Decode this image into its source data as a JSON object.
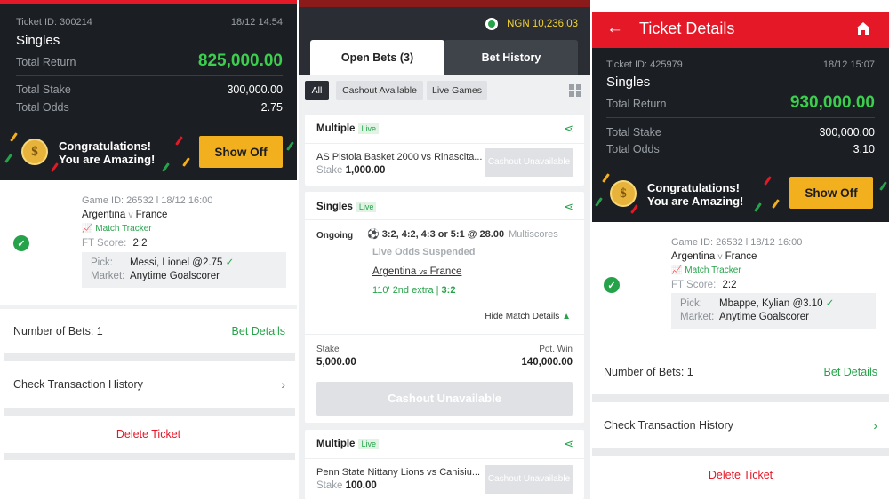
{
  "left": {
    "ticket_id": "Ticket ID: 300214",
    "datetime": "18/12 14:54",
    "type": "Singles",
    "total_return_label": "Total Return",
    "total_return": "825,000.00",
    "total_stake_label": "Total Stake",
    "total_stake": "300,000.00",
    "total_odds_label": "Total Odds",
    "total_odds": "2.75",
    "promo_line1": "Congratulations!",
    "promo_line2": "You are Amazing!",
    "show_off": "Show Off",
    "game_id": "Game ID: 26532 l 18/12 16:00",
    "team_home": "Argentina",
    "vs": "v",
    "team_away": "France",
    "match_tracker": "Match Tracker",
    "ft_score_label": "FT Score:",
    "ft_score": "2:2",
    "pick_label": "Pick:",
    "pick": "Messi, Lionel @2.75",
    "market_label": "Market:",
    "market": "Anytime Goalscorer",
    "num_bets": "Number of Bets: 1",
    "bet_details": "Bet Details",
    "check_history": "Check Transaction History",
    "delete": "Delete Ticket"
  },
  "middle": {
    "balance": "NGN 10,236.03",
    "tabs": [
      "Open Bets (3)",
      "Bet History"
    ],
    "filters": [
      "All",
      "Cashout Available",
      "Live Games"
    ],
    "card1": {
      "title": "Multiple",
      "live": "Live",
      "match": "AS Pistoia Basket 2000 vs Rinascita...",
      "stake_label": "Stake",
      "stake": "1,000.00",
      "cashout": "Cashout Unavailable"
    },
    "card2": {
      "title": "Singles",
      "live": "Live",
      "status": "Ongoing",
      "selection": "3:2, 4:2, 4:3 or 5:1 @ 28.00",
      "market": "Multiscores",
      "suspended": "Live Odds Suspended",
      "match_home": "Argentina",
      "match_vs": "vs",
      "match_away": "France",
      "live_time": "110' 2nd extra |",
      "live_score": "3:2",
      "hide": "Hide Match Details",
      "stake_label": "Stake",
      "stake": "5,000.00",
      "pot_win_label": "Pot. Win",
      "pot_win": "140,000.00",
      "cashout": "Cashout Unavailable"
    },
    "card3": {
      "title": "Multiple",
      "live": "Live",
      "match": "Penn State Nittany Lions vs Canisiu...",
      "stake_label": "Stake",
      "stake": "100.00",
      "cashout": "Cashout Unavailable"
    }
  },
  "right": {
    "header_title": "Ticket Details",
    "ticket_id": "Ticket ID: 425979",
    "datetime": "18/12 15:07",
    "type": "Singles",
    "total_return_label": "Total Return",
    "total_return": "930,000.00",
    "total_stake_label": "Total Stake",
    "total_stake": "300,000.00",
    "total_odds_label": "Total Odds",
    "total_odds": "3.10",
    "promo_line1": "Congratulations!",
    "promo_line2": "You are Amazing!",
    "show_off": "Show Off",
    "game_id": "Game ID: 26532 l 18/12 16:00",
    "team_home": "Argentina",
    "vs": "v",
    "team_away": "France",
    "match_tracker": "Match Tracker",
    "ft_score_label": "FT Score:",
    "ft_score": "2:2",
    "pick_label": "Pick:",
    "pick": "Mbappe, Kylian @3.10",
    "market_label": "Market:",
    "market": "Anytime Goalscorer",
    "num_bets": "Number of Bets: 1",
    "bet_details": "Bet Details",
    "check_history": "Check Transaction History",
    "delete": "Delete Ticket"
  },
  "colors": {
    "brand_red": "#e41827",
    "accent_green": "#26a34a",
    "show_off_yellow": "#f2b01e",
    "dark_bg": "#1b1e23"
  },
  "icons": [
    "back-arrow-icon",
    "home-icon",
    "coin-icon",
    "check-circle-icon",
    "check-icon",
    "chart-line-icon",
    "chevron-right-icon",
    "share-icon",
    "grid-icon",
    "soccer-ball-icon",
    "caret-up-icon",
    "globe-icon"
  ]
}
